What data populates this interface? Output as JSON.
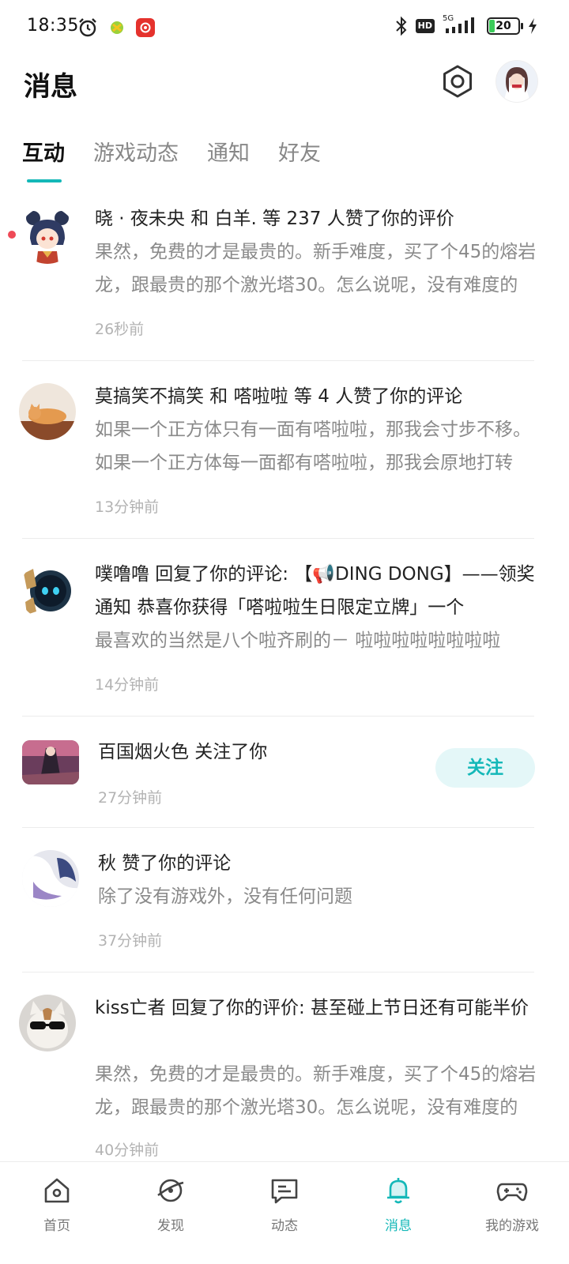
{
  "status_bar": {
    "time": "18:35",
    "battery_level": "20",
    "network": "5G",
    "hd_label": "HD"
  },
  "header": {
    "title": "消息"
  },
  "tabs": [
    {
      "label": "互动",
      "active": true
    },
    {
      "label": "游戏动态",
      "active": false
    },
    {
      "label": "通知",
      "active": false
    },
    {
      "label": "好友",
      "active": false
    }
  ],
  "messages": [
    {
      "title": "晓 · 夜未央 和 白羊. 等 237 人赞了你的评价",
      "body": "果然，免费的才是最贵的。新手难度，买了个45的熔岩龙，跟最贵的那个激光塔30。怎么说呢，没有难度的",
      "time": "26秒前",
      "unread": true
    },
    {
      "title": "莫搞笑不搞笑 和 嗒啦啦 等 4 人赞了你的评论",
      "body": "如果一个正方体只有一面有嗒啦啦，那我会寸步不移。如果一个正方体每一面都有嗒啦啦，那我会原地打转",
      "time": "13分钟前"
    },
    {
      "title": "噗噜噜 回复了你的评论: 【📢DING DONG】——领奖通知 恭喜你获得「嗒啦啦生日限定立牌」一个",
      "body": "最喜欢的当然是八个啦齐刷的－ 啦啦啦啦啦啦啦啦",
      "time": "14分钟前"
    },
    {
      "title": "百国烟火色 关注了你",
      "time": "27分钟前",
      "action_label": "关注"
    },
    {
      "title": "秋 赞了你的评论",
      "body": "除了没有游戏外，没有任何问题",
      "time": "37分钟前"
    },
    {
      "title": "kiss亡者 回复了你的评价: 甚至碰上节日还有可能半价",
      "body": "果然，免费的才是最贵的。新手难度，买了个45的熔岩龙，跟最贵的那个激光塔30。怎么说呢，没有难度的",
      "time": "40分钟前"
    }
  ],
  "bottom_nav": [
    {
      "label": "首页",
      "icon": "home-icon"
    },
    {
      "label": "发现",
      "icon": "discover-icon"
    },
    {
      "label": "动态",
      "icon": "feed-icon"
    },
    {
      "label": "消息",
      "icon": "bell-icon",
      "active": true
    },
    {
      "label": "我的游戏",
      "icon": "gamepad-icon"
    }
  ],
  "colors": {
    "accent": "#14b8b8",
    "unread_dot": "#ef4a57",
    "follow_bg": "#e4f7f8"
  }
}
